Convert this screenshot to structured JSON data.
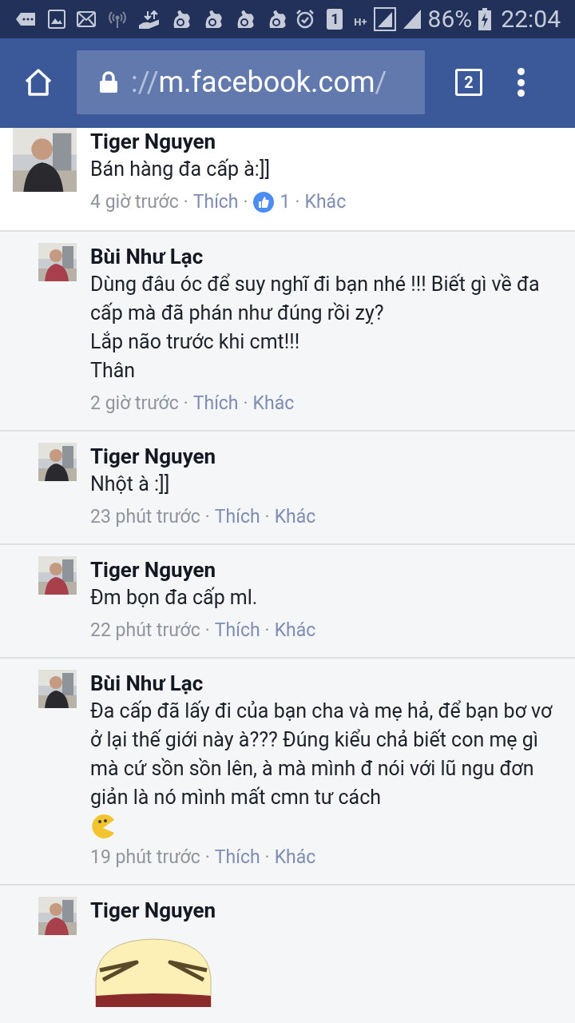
{
  "status_bar": {
    "sim": "1",
    "network": "H+",
    "battery": "86%",
    "time": "22:04"
  },
  "browser": {
    "url_scheme": "://",
    "url_host": "m.facebook.com",
    "url_path": "/",
    "tab_count": "2"
  },
  "comments": [
    {
      "author": "Tiger Nguyen",
      "lines": [
        "Bán hàng đa cấp à:]]"
      ],
      "meta": [
        {
          "kind": "time",
          "text": "4 giờ trước"
        },
        {
          "kind": "separator",
          "text": "·"
        },
        {
          "kind": "link",
          "text": "Thích"
        },
        {
          "kind": "separator",
          "text": "·"
        },
        {
          "kind": "reactions",
          "text": "1"
        },
        {
          "kind": "separator",
          "text": "·"
        },
        {
          "kind": "link",
          "text": "Khác"
        }
      ],
      "children": [
        {
          "author": "Bùi Như Lạc",
          "lines": [
            "Dùng đâu óc để suy nghĩ đi bạn nhé !!! Biết gì về đa cấp mà đã phán như đúng rồi zỵ?",
            "Lắp não trước khi cmt!!!",
            "Thân"
          ],
          "meta": [
            {
              "kind": "time",
              "text": "2 giờ trước"
            },
            {
              "kind": "separator",
              "text": "·"
            },
            {
              "kind": "link",
              "text": "Thích"
            },
            {
              "kind": "separator",
              "text": "·"
            },
            {
              "kind": "link",
              "text": "Khác"
            }
          ]
        },
        {
          "author": "Tiger Nguyen",
          "lines": [
            "Nhột à :]]"
          ],
          "meta": [
            {
              "kind": "time",
              "text": "23 phút trước"
            },
            {
              "kind": "separator",
              "text": "·"
            },
            {
              "kind": "link",
              "text": "Thích"
            },
            {
              "kind": "separator",
              "text": "·"
            },
            {
              "kind": "link",
              "text": "Khác"
            }
          ]
        },
        {
          "author": "Tiger Nguyen",
          "lines": [
            "Đm bọn đa cấp ml."
          ],
          "meta": [
            {
              "kind": "time",
              "text": "22 phút trước"
            },
            {
              "kind": "separator",
              "text": "·"
            },
            {
              "kind": "link",
              "text": "Thích"
            },
            {
              "kind": "separator",
              "text": "·"
            },
            {
              "kind": "link",
              "text": "Khác"
            }
          ]
        },
        {
          "author": "Bùi Như Lạc",
          "lines": [
            "Đa cấp đã lấy đi của bạn cha và mẹ hả, để bạn bơ vơ ở lại thế giới này à??? Đúng kiểu chả biết con mẹ gì mà cứ sồn sồn lên, à mà mình đ nói với lũ ngu đơn giản là nó mình mất cmn tư cách"
          ],
          "emoji": true,
          "meta": [
            {
              "kind": "time",
              "text": "19 phút trước"
            },
            {
              "kind": "separator",
              "text": "·"
            },
            {
              "kind": "link",
              "text": "Thích"
            },
            {
              "kind": "separator",
              "text": "·"
            },
            {
              "kind": "link",
              "text": "Khác"
            }
          ]
        },
        {
          "author": "Tiger Nguyen",
          "sticker": true
        }
      ]
    }
  ]
}
